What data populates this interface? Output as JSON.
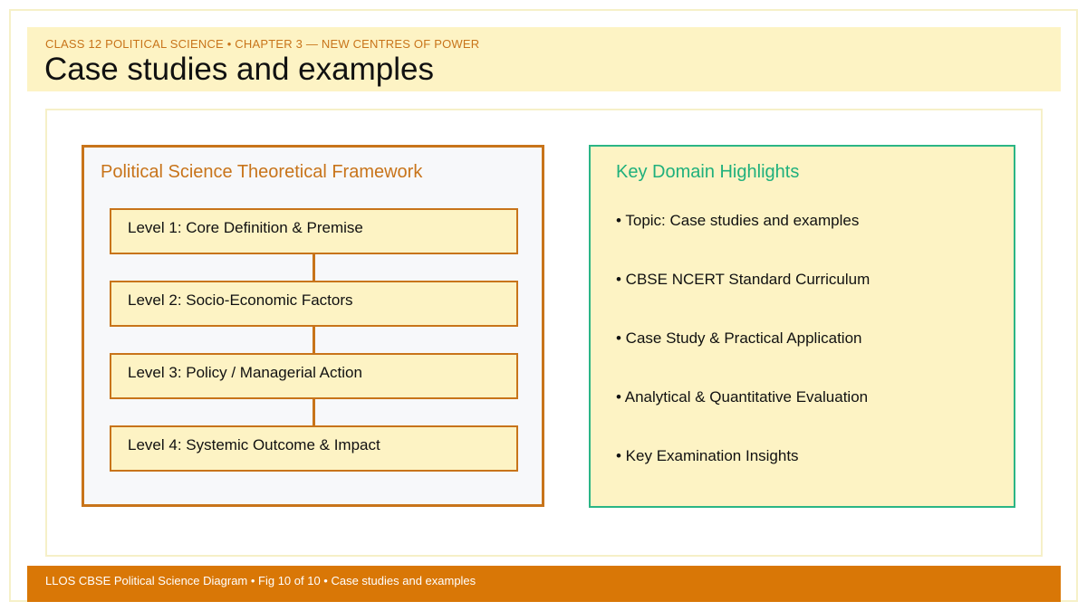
{
  "header": {
    "kicker": "CLASS 12 POLITICAL SCIENCE • CHAPTER 3 — NEW CENTRES OF POWER",
    "title": "Case studies and examples"
  },
  "framework": {
    "title": "Political Science Theoretical Framework",
    "levels": [
      "Level 1: Core Definition & Premise",
      "Level 2: Socio-Economic Factors",
      "Level 3: Policy / Managerial Action",
      "Level 4: Systemic Outcome & Impact"
    ]
  },
  "highlights": {
    "title": "Key Domain Highlights",
    "items": [
      "• Topic: Case studies and examples",
      "• CBSE NCERT Standard Curriculum",
      "• Case Study & Practical Application",
      "• Analytical & Quantitative Evaluation",
      "• Key Examination Insights"
    ]
  },
  "footer": {
    "text": "LLOS CBSE Political Science Diagram • Fig 10 of 10 • Case studies and examples"
  },
  "colors": {
    "accent_orange": "#c8741a",
    "accent_green": "#2bb585",
    "band_yellow": "#fdf3c4",
    "footer_orange": "#d97706"
  }
}
